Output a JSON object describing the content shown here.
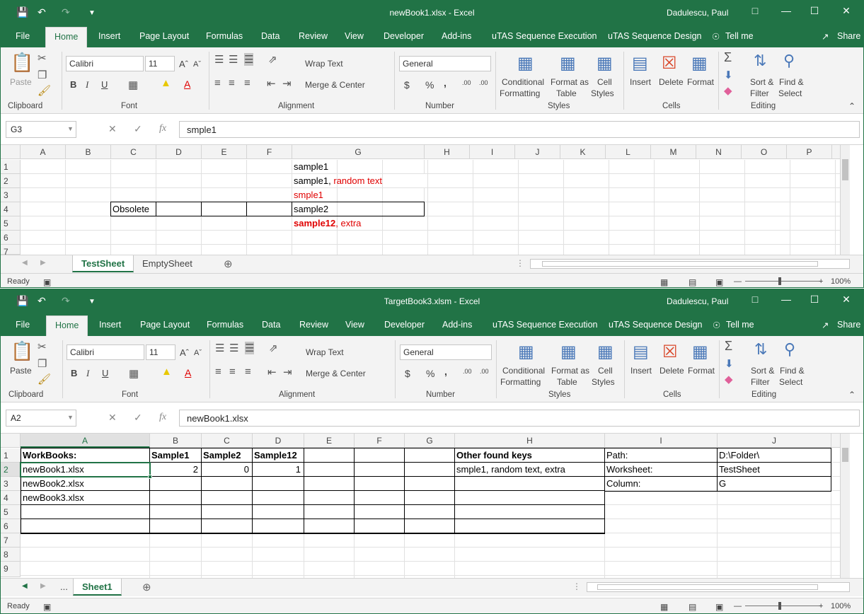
{
  "window1": {
    "title": "newBook1.xlsx  -  Excel",
    "user": "Dadulescu, Paul",
    "name_box": "G3",
    "formula": "smple1",
    "columns": [
      "A",
      "B",
      "C",
      "D",
      "E",
      "F",
      "G",
      "H",
      "I",
      "J",
      "K",
      "L",
      "M",
      "N",
      "O",
      "P"
    ],
    "rows": [
      "1",
      "2",
      "3",
      "4",
      "5",
      "6",
      "7"
    ],
    "cells": {
      "G1": "sample1",
      "G2a": "sample1,",
      "G2b": "random text",
      "G3": "smple1",
      "C4": "Obsolete",
      "G4": "sample2",
      "G5a": "sample12",
      "G5b": ", extra"
    },
    "sheets": [
      "TestSheet",
      "EmptySheet"
    ],
    "status": "Ready",
    "zoom": "100%"
  },
  "window2": {
    "title": "TargetBook3.xlsm  -  Excel",
    "user": "Dadulescu, Paul",
    "name_box": "A2",
    "formula": "newBook1.xlsx",
    "columns": [
      "A",
      "B",
      "C",
      "D",
      "E",
      "F",
      "G",
      "H",
      "I",
      "J"
    ],
    "rows": [
      "1",
      "2",
      "3",
      "4",
      "5",
      "6",
      "7",
      "8",
      "9"
    ],
    "cells": {
      "A1": "WorkBooks:",
      "B1": "Sample1",
      "C1": "Sample2",
      "D1": "Sample12",
      "H1": "Other found keys",
      "I1": "Path:",
      "J1": "D:\\Folder\\",
      "A2": "newBook1.xlsx",
      "B2": "2",
      "C2": "0",
      "D2": "1",
      "H2": "smple1, random text, extra",
      "I2": "Worksheet:",
      "J2": "TestSheet",
      "A3": "newBook2.xlsx",
      "I3": "Column:",
      "J3": "G",
      "A4": "newBook3.xlsx"
    },
    "sheets": [
      "Sheet1"
    ],
    "sheet_ellipsis": "...",
    "status": "Ready",
    "zoom": "100%"
  },
  "ribbon": {
    "tabs": [
      "File",
      "Home",
      "Insert",
      "Page Layout",
      "Formulas",
      "Data",
      "Review",
      "View",
      "Developer",
      "Add-ins",
      "uTAS Sequence Execution",
      "uTAS Sequence Design"
    ],
    "tell_me": "Tell me",
    "share": "Share",
    "paste": "Paste",
    "font_name": "Calibri",
    "font_size": "11",
    "wrap_text": "Wrap Text",
    "merge_center": "Merge & Center",
    "number_format": "General",
    "conditional_1": "Conditional",
    "conditional_2": "Formatting",
    "format_as_1": "Format as",
    "format_as_2": "Table",
    "cell_styles_1": "Cell",
    "cell_styles_2": "Styles",
    "insert": "Insert",
    "delete": "Delete",
    "format": "Format",
    "sort_1": "Sort &",
    "sort_2": "Filter",
    "find_1": "Find &",
    "find_2": "Select",
    "groups": {
      "clipboard": "Clipboard",
      "font": "Font",
      "alignment": "Alignment",
      "number": "Number",
      "styles": "Styles",
      "cells": "Cells",
      "editing": "Editing"
    },
    "bold": "B",
    "italic": "I",
    "underline": "U",
    "currency": "$",
    "percent": "%",
    "comma": ","
  },
  "colors": {
    "excel_green": "#217346",
    "red_text": "#e00000"
  },
  "icons": [
    "save-icon",
    "undo-icon",
    "redo-icon",
    "cut-icon",
    "copy-icon",
    "format-painter-icon",
    "fx-icon",
    "sum-icon",
    "fill-icon",
    "clear-icon",
    "add-sheet-icon",
    "lightbulb-icon",
    "share-icon"
  ]
}
